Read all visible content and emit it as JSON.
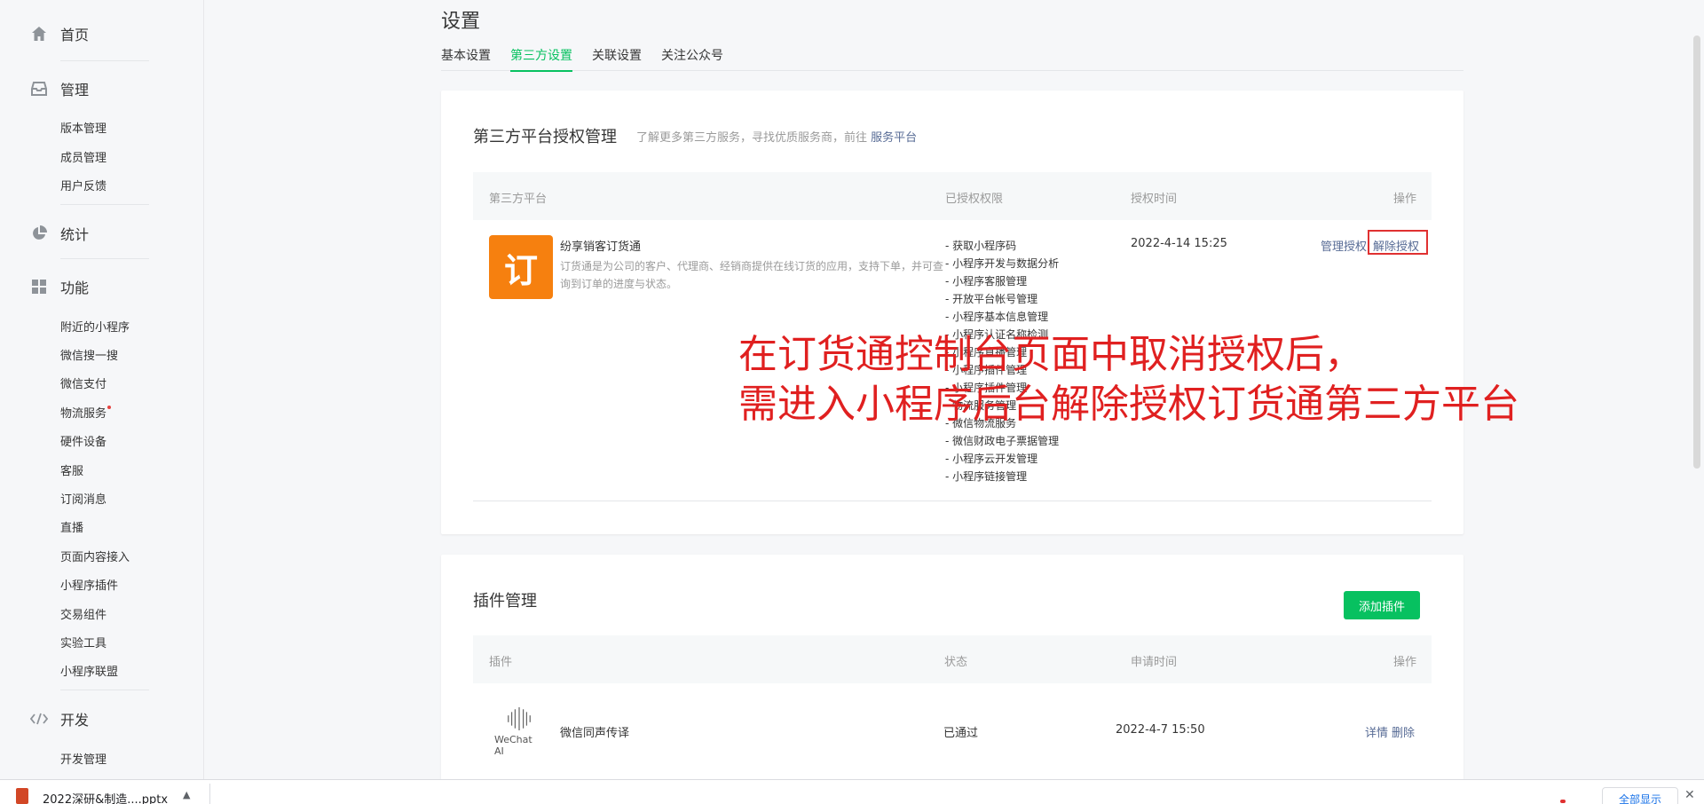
{
  "sidebar": {
    "home": {
      "label": "首页",
      "icon": "home-icon"
    },
    "manage": {
      "label": "管理",
      "icon": "inbox-icon",
      "items": [
        "版本管理",
        "成员管理",
        "用户反馈"
      ]
    },
    "stats": {
      "label": "统计",
      "icon": "pie-chart-icon"
    },
    "features": {
      "label": "功能",
      "icon": "grid-icon",
      "items": [
        "附近的小程序",
        "微信搜一搜",
        "微信支付",
        "物流服务",
        "硬件设备",
        "客服",
        "订阅消息",
        "直播",
        "页面内容接入",
        "小程序插件",
        "交易组件",
        "实验工具",
        "小程序联盟"
      ]
    },
    "dev": {
      "label": "开发",
      "icon": "code-icon",
      "items": [
        "开发管理"
      ]
    }
  },
  "page": {
    "title": "设置",
    "tabs": [
      "基本设置",
      "第三方设置",
      "关联设置",
      "关注公众号"
    ],
    "active_tab": "第三方设置"
  },
  "third_party": {
    "title": "第三方平台授权管理",
    "subtitle": "了解更多第三方服务，寻找优质服务商，前往",
    "subtitle_link": "服务平台",
    "columns": [
      "第三方平台",
      "已授权权限",
      "授权时间",
      "操作"
    ],
    "row": {
      "logo_text": "订",
      "name": "纷享销客订货通",
      "desc": "订货通是为公司的客户、代理商、经销商提供在线订货的应用，支持下单，并可查询到订单的进度与状态。",
      "permissions": [
        "- 获取小程序码",
        "- 小程序开发与数据分析",
        "- 小程序客服管理",
        "- 开放平台帐号管理",
        "- 小程序基本信息管理",
        "- 小程序认证名称检测",
        "- 小程序直播管理",
        "- 小程序插件管理",
        "- 小程序插件管理",
        "- 物流服务管理",
        "- 微信物流服务",
        "- 微信财政电子票据管理",
        "- 小程序云开发管理",
        "- 小程序链接管理"
      ],
      "time": "2022-4-14 15:25",
      "actions": {
        "manage": "管理授权",
        "revoke": "解除授权"
      }
    }
  },
  "plugins": {
    "title": "插件管理",
    "add_button": "添加插件",
    "columns": [
      "插件",
      "状态",
      "申请时间",
      "操作"
    ],
    "row": {
      "logo_brand": "WeChat AI",
      "name": "微信同声传译",
      "status": "已通过",
      "time": "2022-4-7 15:50",
      "actions": {
        "detail": "详情",
        "delete": "删除"
      }
    }
  },
  "annotation": {
    "line1": "在订货通控制台页面中取消授权后，",
    "line2": "需进入小程序后台解除授权订货通第三方平台",
    "color": "#e02020"
  },
  "download_bar": {
    "file_name": "2022深研&制造....pptx",
    "show_all": "全部显示"
  },
  "colors": {
    "accent": "#07c160",
    "link": "#576b95",
    "highlight_box": "#e03131",
    "app_logo": "#f6800f"
  }
}
